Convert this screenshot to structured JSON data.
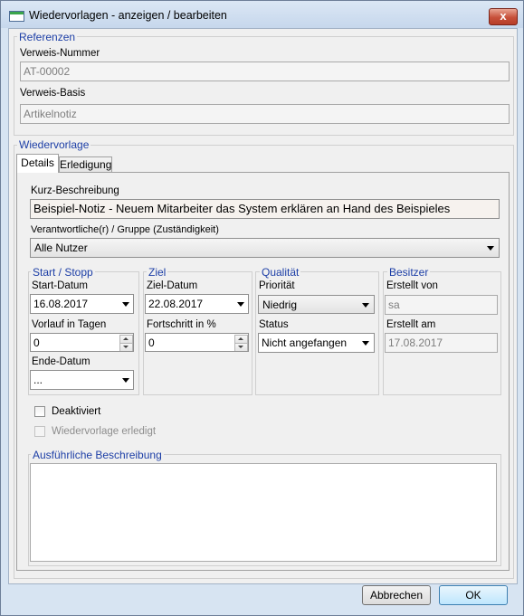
{
  "window": {
    "title": "Wiedervorlagen - anzeigen / bearbeiten",
    "close_glyph": "x",
    "app_icon": "window-app-icon",
    "close_icon": "close-icon"
  },
  "referenzen": {
    "title": "Referenzen",
    "verweis_nummer_label": "Verweis-Nummer",
    "verweis_nummer_value": "AT-00002",
    "verweis_basis_label": "Verweis-Basis",
    "verweis_basis_value": "Artikelnotiz"
  },
  "wiedervorlage": {
    "title": "Wiedervorlage",
    "tabs": [
      {
        "label": "Details",
        "active": true
      },
      {
        "label": "Erledigung",
        "active": false
      }
    ],
    "kurz_label": "Kurz-Beschreibung",
    "kurz_value": "Beispiel-Notiz - Neuem Mitarbeiter das System erklären an Hand des Beispieles",
    "verantwortlich_label": "Verantwortliche(r) / Gruppe  (Zuständigkeit)",
    "verantwortlich_value": "Alle Nutzer",
    "start_stopp": {
      "title": "Start / Stopp",
      "start_label": "Start-Datum",
      "start_value": "16.08.2017",
      "vorlauf_label": "Vorlauf in Tagen",
      "vorlauf_value": "0",
      "ende_label": "Ende-Datum",
      "ende_value": "..."
    },
    "ziel": {
      "title": "Ziel",
      "ziel_label": "Ziel-Datum",
      "ziel_value": "22.08.2017",
      "fortschritt_label": "Fortschritt in %",
      "fortschritt_value": "0"
    },
    "qualitaet": {
      "title": "Qualität",
      "prioritaet_label": "Priorität",
      "prioritaet_value": "Niedrig",
      "status_label": "Status",
      "status_value": "Nicht angefangen"
    },
    "besitzer": {
      "title": "Besitzer",
      "erstellt_von_label": "Erstellt von",
      "erstellt_von_value": "sa",
      "erstellt_am_label": "Erstellt am",
      "erstellt_am_value": "17.08.2017"
    },
    "deaktiviert_label": "Deaktiviert",
    "deaktiviert_checked": false,
    "erledigt_label": "Wiedervorlage erledigt",
    "erledigt_checked": false,
    "ausfuehrlich_title": "Ausführliche Beschreibung",
    "ausfuehrlich_value": ""
  },
  "buttons": {
    "cancel": "Abbrechen",
    "ok": "OK"
  },
  "colors": {
    "group_title": "#1c3ea6",
    "frame": "#d7e4f2",
    "close_button": "#c7503a"
  }
}
